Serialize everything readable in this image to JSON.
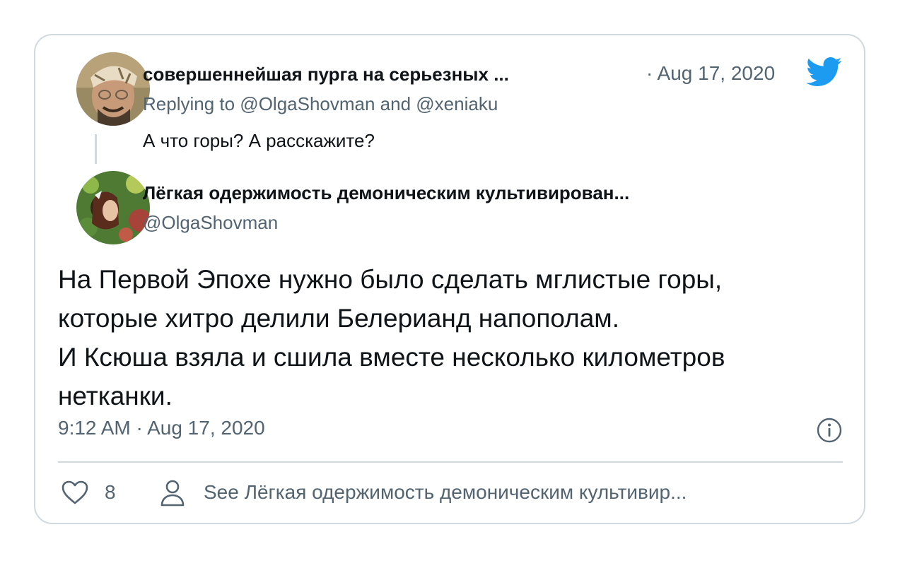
{
  "quoted_tweet": {
    "author_name": "совершеннейшая пурга на серьезных ...",
    "date": "· Aug 17, 2020",
    "replying_to": "Replying to @OlgaShovman and @xeniaku",
    "text": "А что горы? А расскажите?"
  },
  "main_tweet": {
    "author_name": "Лёгкая одержимость демоническим культивирован...",
    "handle": "@OlgaShovman",
    "text_lines": [
      "На Первой Эпохе нужно было сделать мглистые горы,",
      "которые хитро делили Белерианд напополам.",
      "И Ксюша взяла и сшила вместе несколько километров",
      "нетканки."
    ],
    "timestamp": "9:12 AM · Aug 17, 2020"
  },
  "footer": {
    "like_count": "8",
    "see_link": "See Лёгкая одержимость демоническим культивир..."
  },
  "icons": {
    "brand": "twitter-bird-icon",
    "info": "info-icon",
    "like": "heart-icon",
    "profile": "person-icon"
  },
  "colors": {
    "twitter_blue": "#1d9bf0",
    "secondary_text": "#536471",
    "primary_text": "#0f1419",
    "border": "#cfd9de"
  }
}
